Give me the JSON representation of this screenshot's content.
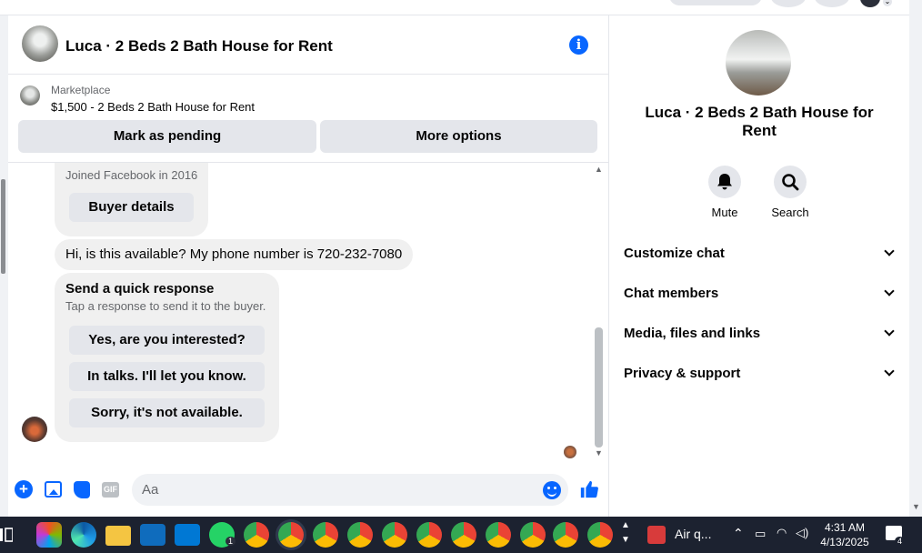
{
  "chat": {
    "title": "Luca · 2 Beds 2 Bath House for Rent",
    "listing": {
      "source": "Marketplace",
      "title": "$1,500 - 2 Beds 2 Bath House for Rent",
      "mark_pending_label": "Mark as pending",
      "more_options_label": "More options"
    },
    "messages": {
      "joined": "Joined Facebook in 2016",
      "buyer_details_label": "Buyer details",
      "incoming_text": "Hi, is this available? My phone number is 720-232-7080",
      "quick_response": {
        "title": "Send a quick response",
        "subtitle": "Tap a response to send it to the buyer.",
        "options": [
          "Yes, are you interested?",
          "In talks. I'll let you know.",
          "Sorry, it's not available."
        ]
      }
    },
    "composer": {
      "placeholder": "Aa",
      "gif_label": "GIF"
    }
  },
  "details": {
    "title": "Luca · 2 Beds 2 Bath House for Rent",
    "actions": [
      "Mute",
      "Search"
    ],
    "sections": [
      "Customize chat",
      "Chat members",
      "Media, files and links",
      "Privacy & support"
    ]
  },
  "taskbar": {
    "weather_label": "Air q...",
    "time": "4:31 AM",
    "date": "4/13/2025",
    "whatsapp_badge": "1",
    "notification_count": "4"
  },
  "colors": {
    "accent": "#0866ff",
    "button_gray": "#e4e6eb",
    "bubble_gray": "#f0f0f0",
    "taskbar": "#1c2230"
  }
}
